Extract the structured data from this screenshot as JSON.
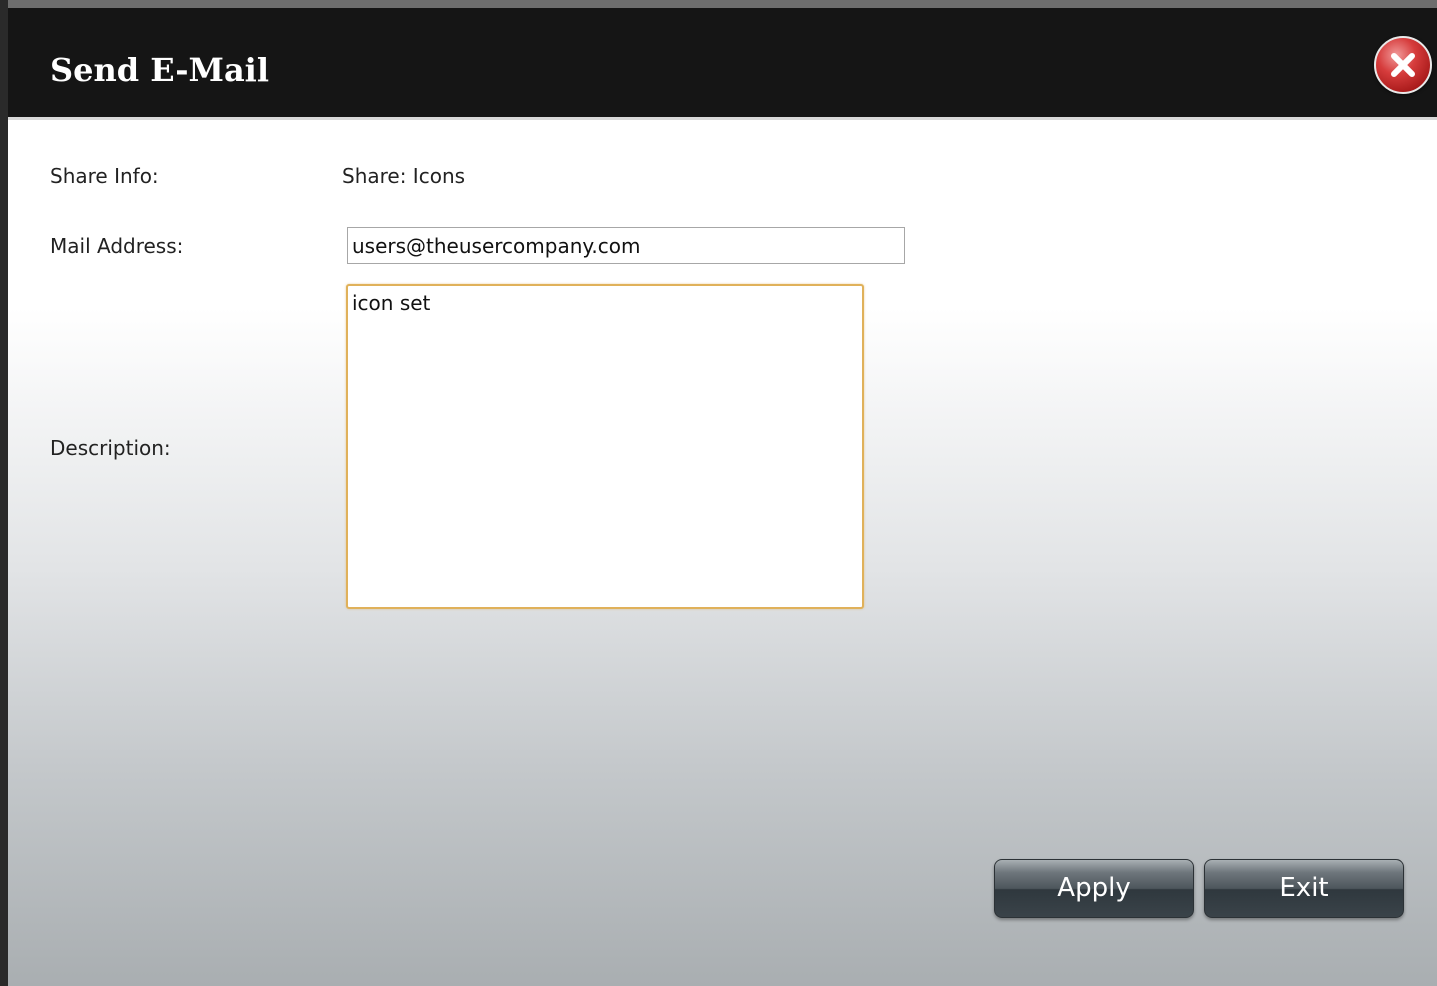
{
  "dialog": {
    "title": "Send E-Mail",
    "close_icon": "close-icon"
  },
  "form": {
    "share_info_label": "Share Info:",
    "share_info_value": "Share: Icons",
    "mail_address_label": "Mail Address:",
    "mail_address_value": "users@theusercompany.com",
    "description_label": "Description:",
    "description_value": "icon set"
  },
  "buttons": {
    "apply_label": "Apply",
    "exit_label": "Exit"
  },
  "colors": {
    "titlebar": "#151515",
    "close_button": "#d63c3c",
    "textarea_focus_border": "#e0b15a"
  }
}
